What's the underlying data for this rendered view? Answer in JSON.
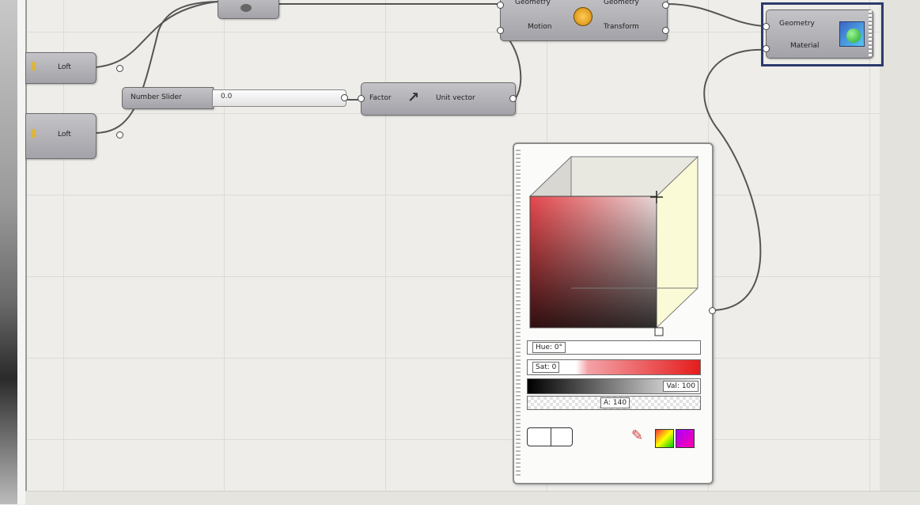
{
  "canvas": {
    "background": "#eeede9"
  },
  "components": {
    "loft_top": {
      "label": "Loft"
    },
    "loft_bottom": {
      "label": "Loft"
    },
    "number_slider": {
      "label": "Number Slider",
      "value": "0.0"
    },
    "unit_vector": {
      "input": "Factor",
      "output": "Unit vector"
    },
    "move": {
      "input_geometry": "Geometry",
      "input_motion": "Motion",
      "output_geometry": "Geometry",
      "output_transform": "Transform"
    },
    "custom_preview": {
      "input_geometry": "Geometry",
      "input_material": "Material"
    }
  },
  "swatch": {
    "hue_label": "Hue: 0°",
    "sat_label": "Sat: 0",
    "val_label": "Val: 100",
    "alpha_label": "A: 140",
    "accent_color": "#e51c1c"
  },
  "highlight_color": "#2c3a6c"
}
